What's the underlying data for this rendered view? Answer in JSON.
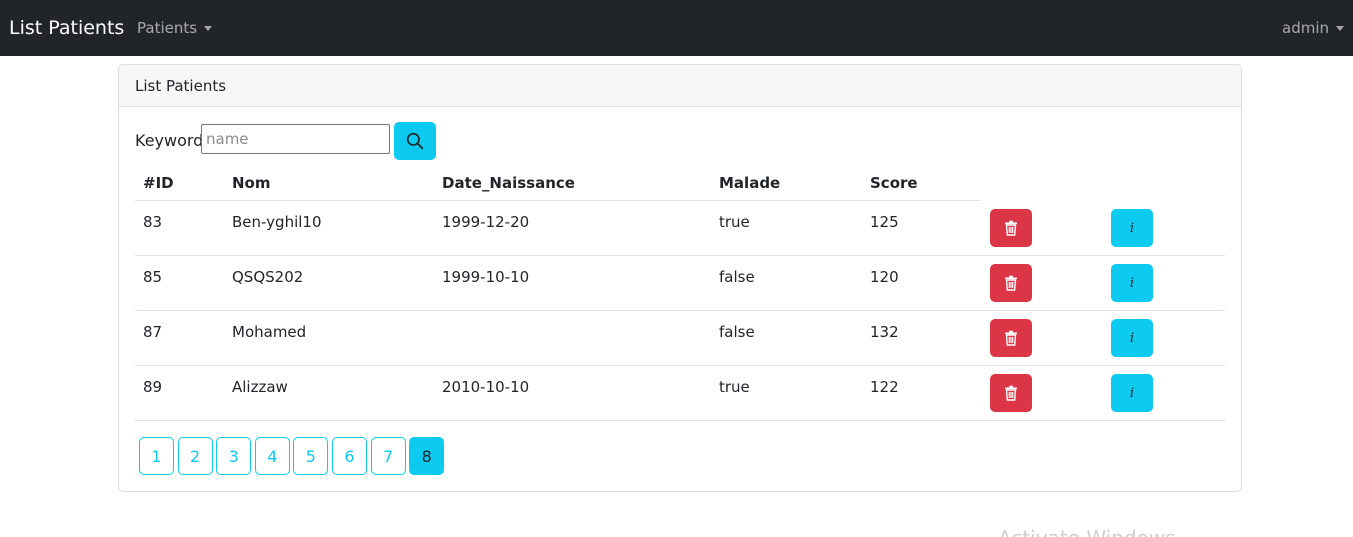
{
  "navbar": {
    "brand": "List Patients",
    "menu_patients": "Patients",
    "menu_user": "admin"
  },
  "card": {
    "header": "List Patients"
  },
  "search": {
    "label": "Keyword",
    "value": "",
    "placeholder": "name",
    "icon": "search-icon"
  },
  "table": {
    "columns": [
      "#ID",
      "Nom",
      "Date_Naissance",
      "Malade",
      "Score"
    ],
    "rows": [
      {
        "id": "83",
        "nom": "Ben-yghil10",
        "date": "1999-12-20",
        "malade": "true",
        "score": "125"
      },
      {
        "id": "85",
        "nom": "QSQS202",
        "date": "1999-10-10",
        "malade": "false",
        "score": "120"
      },
      {
        "id": "87",
        "nom": "Mohamed",
        "date": "",
        "malade": "false",
        "score": "132"
      },
      {
        "id": "89",
        "nom": "Alizzaw",
        "date": "2010-10-10",
        "malade": "true",
        "score": "122"
      }
    ],
    "delete_icon": "trash-icon",
    "info_label": "i"
  },
  "pagination": {
    "pages": [
      "1",
      "2",
      "3",
      "4",
      "5",
      "6",
      "7",
      "8"
    ],
    "current": "8"
  },
  "watermark": "Activate Windows",
  "colors": {
    "navbar_bg": "#212529",
    "info": "#0dcaf0",
    "danger": "#dc3545"
  }
}
